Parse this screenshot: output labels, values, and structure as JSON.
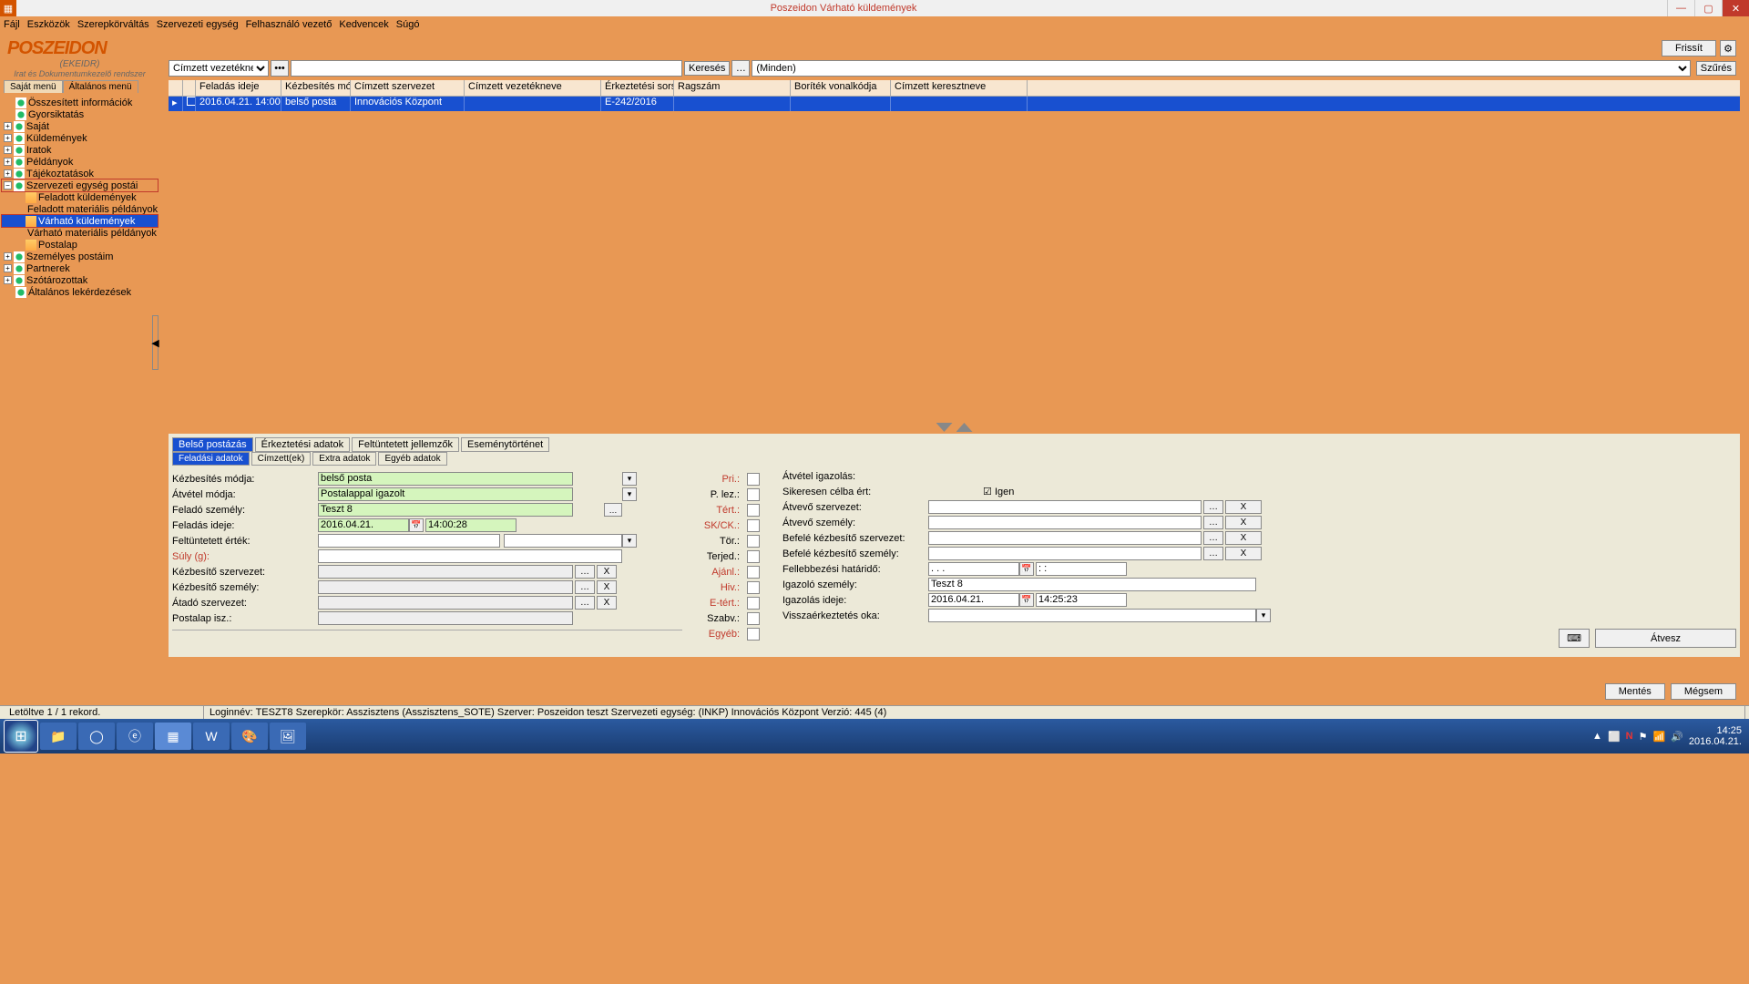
{
  "window": {
    "title": "Poszeidon Várható küldemények"
  },
  "menubar": [
    "Fájl",
    "Eszközök",
    "Szerepkörváltás",
    "Szervezeti egység",
    "Felhasználó vezető",
    "Kedvencek",
    "Súgó"
  ],
  "logo": {
    "main": "POSZEIDON",
    "sub1": "(EKEIDR)",
    "sub2": "Irat és Dokumentumkezelő rendszer"
  },
  "sidebar_tabs": {
    "a": "Saját menü",
    "b": "Általános menü"
  },
  "tree": {
    "t1": "Összesített információk",
    "t2": "Gyorsiktatás",
    "t3": "Saját",
    "t4": "Küldemények",
    "t5": "Iratok",
    "t6": "Példányok",
    "t7": "Tájékoztatások",
    "t8": "Szervezeti egység postái",
    "t8a": "Feladott küldemények",
    "t8b": "Feladott materiális példányok",
    "t8c": "Várható küldemények",
    "t8d": "Várható materiális példányok",
    "t8e": "Postalap",
    "t9": "Személyes postáim",
    "t10": "Partnerek",
    "t11": "Szótározottak",
    "t12": "Általános lekérdezések"
  },
  "top_buttons": {
    "refresh": "Frissít"
  },
  "search": {
    "field_select": "Címzett vezetékneve",
    "search_btn": "Keresés",
    "all": "(Minden)",
    "filter_btn": "Szűrés"
  },
  "grid_headers": {
    "c1": "Feladás ideje",
    "c2": "Kézbesítés módja",
    "c3": "Címzett szervezet",
    "c4": "Címzett vezetékneve",
    "c5": "Érkeztetési sorszám",
    "c6": "Ragszám",
    "c7": "Boríték vonalkódja",
    "c8": "Címzett keresztneve"
  },
  "grid_row": {
    "c1": "2016.04.21. 14:00:28",
    "c2": "belső posta",
    "c3": "Innovációs Központ",
    "c4": "",
    "c5": "E-242/2016",
    "c6": "",
    "c7": "",
    "c8": ""
  },
  "dtabs_top": {
    "a": "Belső postázás",
    "b": "Érkeztetési adatok",
    "c": "Feltüntetett jellemzők",
    "d": "Eseménytörténet"
  },
  "dtabs_sub": {
    "a": "Feladási adatok",
    "b": "Címzett(ek)",
    "c": "Extra adatok",
    "d": "Egyéb adatok"
  },
  "form": {
    "l_kezbesites": "Kézbesítés módja:",
    "v_kezbesites": "belső posta",
    "l_atvetel": "Átvétel módja:",
    "v_atvetel": "Postalappal igazolt",
    "l_felado": "Feladó személy:",
    "v_felado": "Teszt 8",
    "l_feladas": "Feladás ideje:",
    "v_feladas_d": "2016.04.21.",
    "v_feladas_t": "14:00:28",
    "l_feltuntetett": "Feltüntetett érték:",
    "l_suly": "Súly (g):",
    "l_kezbszerv": "Kézbesítő szervezet:",
    "l_kezbszem": "Kézbesítő személy:",
    "l_atado": "Átadó szervezet:",
    "l_postalap": "Postalap isz.:"
  },
  "mid": {
    "pri": "Pri.:",
    "plez": "P. lez.:",
    "tert": "Tért.:",
    "skck": "SK/CK.:",
    "tor": "Tör.:",
    "terjed": "Terjed.:",
    "ajanl": "Ajánl.:",
    "hiv": "Hiv.:",
    "etert": "E-tért.:",
    "szabv": "Szabv.:",
    "egyeb": "Egyéb:"
  },
  "right": {
    "hdr": "Átvétel igazolás:",
    "siker": "Sikeresen célba ért:",
    "igen": "Igen",
    "atvszerv": "Átvevő szervezet:",
    "atvszem": "Átvevő személy:",
    "bkszerv": "Befelé kézbesítő szervezet:",
    "bkszem": "Befelé kézbesítő személy:",
    "felleb": "Fellebbezési határidő:",
    "v_felleb_d": ". . .",
    "v_felleb_t": ": :",
    "igszem": "Igazoló személy:",
    "v_igszem": "Teszt 8",
    "igido": "Igazolás ideje:",
    "v_igido_d": "2016.04.21.",
    "v_igido_t": "14:25:23",
    "visszaok": "Visszaérkeztetés oka:",
    "atvesz": "Átvesz"
  },
  "x_btn": "X",
  "lower": {
    "mentes": "Mentés",
    "megsem": "Mégsem"
  },
  "status": {
    "left": "Letöltve 1 / 1 rekord.",
    "right": "Loginnév: TESZT8  Szerepkör: Asszisztens (Asszisztens_SOTE)  Szerver: Poszeidon teszt  Szervezeti egység: (INKP) Innovációs Központ  Verzió: 445 (4)"
  },
  "taskbar": {
    "time": "14:25",
    "date": "2016.04.21."
  }
}
